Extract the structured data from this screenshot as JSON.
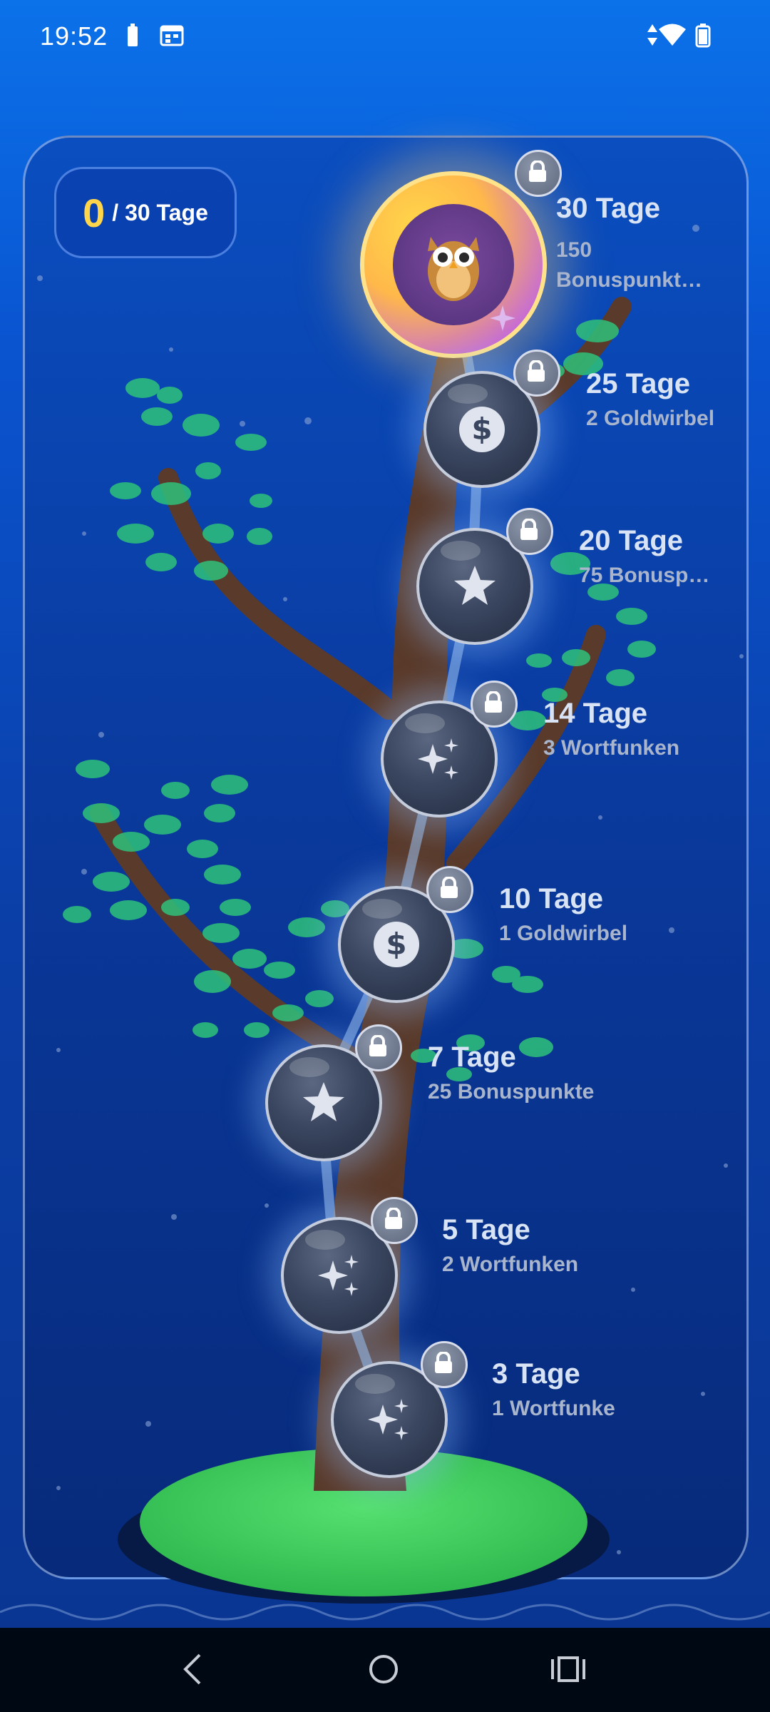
{
  "status_bar": {
    "time": "19:52"
  },
  "counter": {
    "current": "0",
    "total_label": "/ 30 Tage"
  },
  "milestones": [
    {
      "title": "30 Tage",
      "reward": "150 Bonuspunkt…",
      "icon": "owl-icon"
    },
    {
      "title": "25 Tage",
      "reward": "2 Goldwirbel",
      "icon": "dollar-icon"
    },
    {
      "title": "20 Tage",
      "reward": "75 Bonusp…",
      "icon": "star-icon"
    },
    {
      "title": "14 Tage",
      "reward": "3 Wortfunken",
      "icon": "sparkles-icon"
    },
    {
      "title": "10 Tage",
      "reward": "1 Goldwirbel",
      "icon": "dollar-icon"
    },
    {
      "title": "7 Tage",
      "reward": "25 Bonuspunkte",
      "icon": "star-icon"
    },
    {
      "title": "5 Tage",
      "reward": "2 Wortfunken",
      "icon": "sparkles-icon"
    },
    {
      "title": "3 Tage",
      "reward": "1 Wortfunke",
      "icon": "sparkles-icon"
    }
  ],
  "colors": {
    "accent": "#ffd54a",
    "leaf": "#2ecc71",
    "branch": "#5a3a2a",
    "island": "#3fd45f"
  }
}
